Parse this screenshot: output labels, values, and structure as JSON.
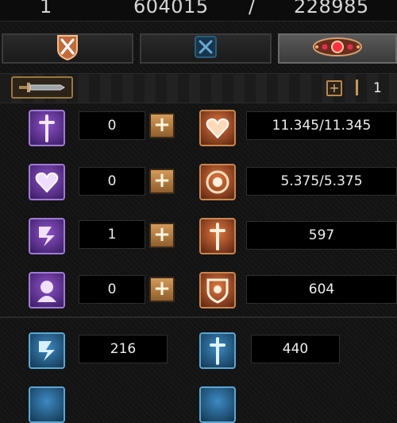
{
  "top_bar": {
    "level": "1",
    "value_left": "604015",
    "separator": "/",
    "value_right": "228985"
  },
  "tabs": [
    {
      "name": "combat",
      "icon": "crossed-swords-shield-icon",
      "active": false
    },
    {
      "name": "skills",
      "icon": "blue-crossed-swords-icon",
      "active": false
    },
    {
      "name": "items",
      "icon": "jeweled-amulet-icon",
      "active": true
    }
  ],
  "weapon_header": {
    "icon": "sword-icon",
    "points_label": "1"
  },
  "base_stats": [
    {
      "icon": "sword-purple-icon",
      "value": "0"
    },
    {
      "icon": "heart-purple-icon",
      "value": "0"
    },
    {
      "icon": "boot-purple-icon",
      "value": "1"
    },
    {
      "icon": "head-purple-icon",
      "value": "0"
    }
  ],
  "derived_stats": [
    {
      "icon": "heart-orange-icon",
      "value": "11.345/11.345"
    },
    {
      "icon": "mana-orb-orange-icon",
      "value": "5.375/5.375"
    },
    {
      "icon": "sword-orange-icon",
      "value": "597"
    },
    {
      "icon": "shield-orange-icon",
      "value": "604"
    }
  ],
  "extra_stats": [
    {
      "icon": "boot-blue-icon",
      "value": "216"
    },
    {
      "icon": "sword-blue-icon",
      "value": "440"
    }
  ],
  "colors": {
    "purple": "#8d52c8",
    "orange": "#e07840",
    "blue": "#3c8ac2",
    "gold": "#c89858"
  }
}
